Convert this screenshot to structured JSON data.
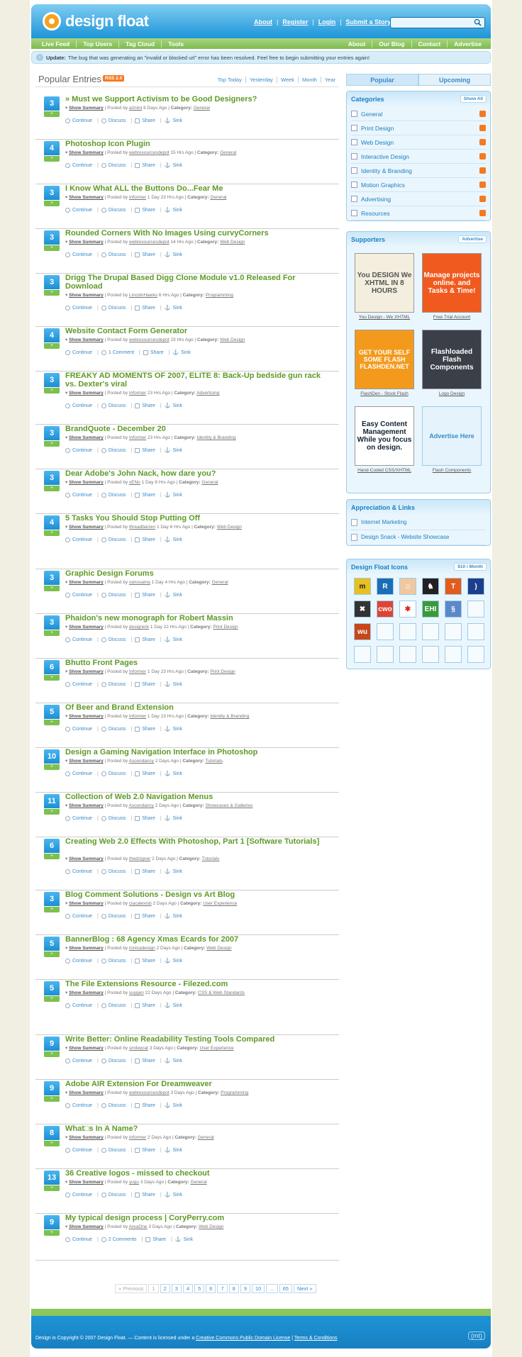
{
  "header": {
    "logo_text": "design float",
    "top_links": [
      "About",
      "Register",
      "Login",
      "Submit a Story"
    ],
    "search_placeholder": ""
  },
  "nav": {
    "left": [
      "Live Feed",
      "Top Users",
      "Tag Cloud",
      "Tools"
    ],
    "right": [
      "About",
      "Our Blog",
      "Contact",
      "Advertise"
    ]
  },
  "update": {
    "label": "Update:",
    "text": "The bug that was generating an \"invalid or blocked url\" error has been resolved. Feel free to begin submitting your entries again!"
  },
  "entries_header": {
    "title": "Popular Entries",
    "rss": "RSS 2.0",
    "time_filters": [
      "Top Today",
      "Yesterday",
      "Week",
      "Month",
      "Year"
    ]
  },
  "entry_labels": {
    "show_summary": "Show Summary",
    "posted_by": "Posted by",
    "category": "Category:",
    "continue": "Continue",
    "discuss": "Discuss",
    "share": "Share",
    "sink": "Sink",
    "vote": "+"
  },
  "entries": [
    {
      "count": "3",
      "title": "» Must we Support Activism to be Good Designers?",
      "user": "aiznini",
      "time": "6 Days Ago",
      "category": "General",
      "discuss": "Discuss"
    },
    {
      "count": "4",
      "title": "Photoshop Icon Plugin",
      "user": "webresourcesdepot",
      "time": "15 Hrs Ago",
      "category": "General",
      "discuss": "Discuss"
    },
    {
      "count": "3",
      "title": "I Know What ALL the Buttons Do...Fear Me",
      "user": "Informer",
      "time": "1 Day 23 Hrs Ago",
      "category": "General",
      "discuss": "Discuss"
    },
    {
      "count": "3",
      "title": "Rounded Corners With No Images Using curvyCorners",
      "user": "webresourcesdepot",
      "time": "14 Hrs Ago",
      "category": "Web Design",
      "discuss": "Discuss"
    },
    {
      "count": "3",
      "title": "Drigg The Drupal Based Digg Clone Module v1.0 Released For Download",
      "user": "LincolnHawks",
      "time": "6 Hrs Ago",
      "category": "Programming",
      "discuss": "Discuss"
    },
    {
      "count": "4",
      "title": "Website Contact Form Generator",
      "user": "webresourcesdepot",
      "time": "23 Hrs Ago",
      "category": "Web Design",
      "discuss": "1 Comment"
    },
    {
      "count": "3",
      "title": "FREAKY AD MOMENTS OF 2007, ELITE 8: Back-Up bedside gun rack vs. Dexter's viral",
      "user": "Informer",
      "time": "23 Hrs Ago",
      "category": "Advertising",
      "discuss": "Discuss"
    },
    {
      "count": "3",
      "title": "BrandQuote - December 20",
      "user": "Informer",
      "time": "23 Hrs Ago",
      "category": "Identity & Branding",
      "discuss": "Discuss"
    },
    {
      "count": "3",
      "title": "Dear Adobe's John Nack, how dare you?",
      "user": "vENo",
      "time": "1 Day 8 Hrs Ago",
      "category": "General",
      "discuss": "Discuss"
    },
    {
      "count": "4",
      "title": "5 Tasks You Should Stop Putting Off",
      "user": "threadbarren",
      "time": "1 Day 6 Hrs Ago",
      "category": "Web Design",
      "discuss": "Discuss"
    },
    {
      "count": "3",
      "title": "Graphic Design Forums",
      "user": "xanosama",
      "time": "1 Day 4 Hrs Ago",
      "category": "General",
      "discuss": "Discuss"
    },
    {
      "count": "3",
      "title": "Phaidon's new monograph for Robert Massin",
      "user": "designerk",
      "time": "1 Day 22 Hrs Ago",
      "category": "Print Design",
      "discuss": "Discuss"
    },
    {
      "count": "6",
      "title": "Bhutto Front Pages",
      "user": "Informer",
      "time": "1 Day 23 Hrs Ago",
      "category": "Print Design",
      "discuss": "Discuss"
    },
    {
      "count": "5",
      "title": "Of Beer and Brand Extension",
      "user": "Informer",
      "time": "1 Day 23 Hrs Ago",
      "category": "Identity & Branding",
      "discuss": "Discuss"
    },
    {
      "count": "10",
      "title": "Design a Gaming Navigation Interface in Photoshop",
      "user": "Ascendancy",
      "time": "2 Days Ago",
      "category": "Tutorials",
      "discuss": "Discuss"
    },
    {
      "count": "11",
      "title": "Collection of Web 2.0 Navigation Menus",
      "user": "Ascendancy",
      "time": "2 Days Ago",
      "category": "Showcases & Galleries",
      "discuss": "Discuss"
    },
    {
      "count": "6",
      "title": "Creating Web 2.0 Effects With Photoshop, Part 1 [Software Tutorials]",
      "user": "thedzigner",
      "time": "2 Days Ago",
      "category": "Tutorials",
      "discuss": "Discuss"
    },
    {
      "count": "3",
      "title": "Blog Comment Solutions - Design vs Art Blog",
      "user": "ciacalexisb",
      "time": "2 Days Ago",
      "category": "User Experience",
      "discuss": "Discuss"
    },
    {
      "count": "5",
      "title": "BannerBlog : 68 Agency Xmas Ecards for 2007",
      "user": "ronicadesign",
      "time": "2 Days Ago",
      "category": "Web Design",
      "discuss": "Discuss"
    },
    {
      "count": "5",
      "title": "The File Extensions Resource - Filezed.com",
      "user": "suygen",
      "time": "22 Days Ago",
      "category": "CSS & Web Standards",
      "discuss": "Discuss"
    },
    {
      "count": "9",
      "title": "Write Better: Online Readability Testing Tools Compared",
      "user": "smileycat",
      "time": "3 Days Ago",
      "category": "User Experience",
      "discuss": "Discuss"
    },
    {
      "count": "9",
      "title": "Adobe AIR Extension For Dreamweaver",
      "user": "webresourcesdepot",
      "time": "3 Days Ago",
      "category": "Programming",
      "discuss": "Discuss"
    },
    {
      "count": "8",
      "title": "What□s In A Name?",
      "user": "Informer",
      "time": "2 Days Ago",
      "category": "General",
      "discuss": "Discuss"
    },
    {
      "count": "13",
      "title": "36 Creative logos - missed to checkout",
      "user": "yugu",
      "time": "3 Days Ago",
      "category": "General",
      "discuss": "Discuss"
    },
    {
      "count": "9",
      "title": "My typical design process | CoryPerry.com",
      "user": "AreaOne",
      "time": "3 Days Ago",
      "category": "Web Design",
      "discuss": "2 Comments"
    }
  ],
  "pager": [
    "« Previous",
    "1",
    "2",
    "3",
    "4",
    "5",
    "6",
    "7",
    "8",
    "9",
    "10",
    "...",
    "65",
    "Next »"
  ],
  "sidebar": {
    "tabs": [
      "Popular",
      "Upcoming"
    ],
    "categories_title": "Categories",
    "categories_btn": "Show All",
    "categories": [
      "General",
      "Print Design",
      "Web Design",
      "Interactive Design",
      "Identity & Branding",
      "Motion Graphics",
      "Advertising",
      "Resources"
    ],
    "supporters_title": "Supporters",
    "supporters_btn": "Advertise",
    "supporters": [
      {
        "ad_text": "You DESIGN We XHTML IN 8 HOURS",
        "caption": "You Design - We XHTML"
      },
      {
        "ad_text": "Manage projects online. and Tasks & Time!",
        "caption": "Free Trial Account"
      },
      {
        "ad_text": "GET YOUR SELF SOME FLASH FLASHDEN.NET",
        "caption": "FlashDen - Stock Flash"
      },
      {
        "ad_text": "Flashloaded Flash Components",
        "caption": "Logo Design"
      },
      {
        "ad_text": "Easy Content Management While you focus on design.",
        "caption": "Hand-Coded CSS/XHTML"
      },
      {
        "ad_text": "Advertise Here",
        "caption": "Flash Components"
      }
    ],
    "links_title": "Appreciation & Links",
    "links": [
      "Internet Marketing",
      "Design Snack - Website Showcase"
    ],
    "icons_title": "Design Float Icons",
    "icons_btn": "$10 / Month",
    "icons": [
      "m",
      "R",
      "☺",
      "♞",
      "T",
      ")",
      "✖",
      "cwo",
      "✱",
      "EHI",
      "§",
      "",
      "wu",
      "",
      "",
      "",
      "",
      "",
      "",
      "",
      "",
      "",
      "",
      ""
    ]
  },
  "footer": {
    "text_prefix": "Design is Copyright © 2007 Design Float. — Content is licensed under a",
    "license_link": "Creative Commons Public Domain License",
    "terms_link": "Terms & Conditions",
    "badge": "(mt)"
  },
  "colors": {
    "brand_blue": "#1d95d8",
    "brand_green": "#7fbb4d",
    "title_green": "#5e9a27",
    "link_blue": "#3b8ac8"
  }
}
